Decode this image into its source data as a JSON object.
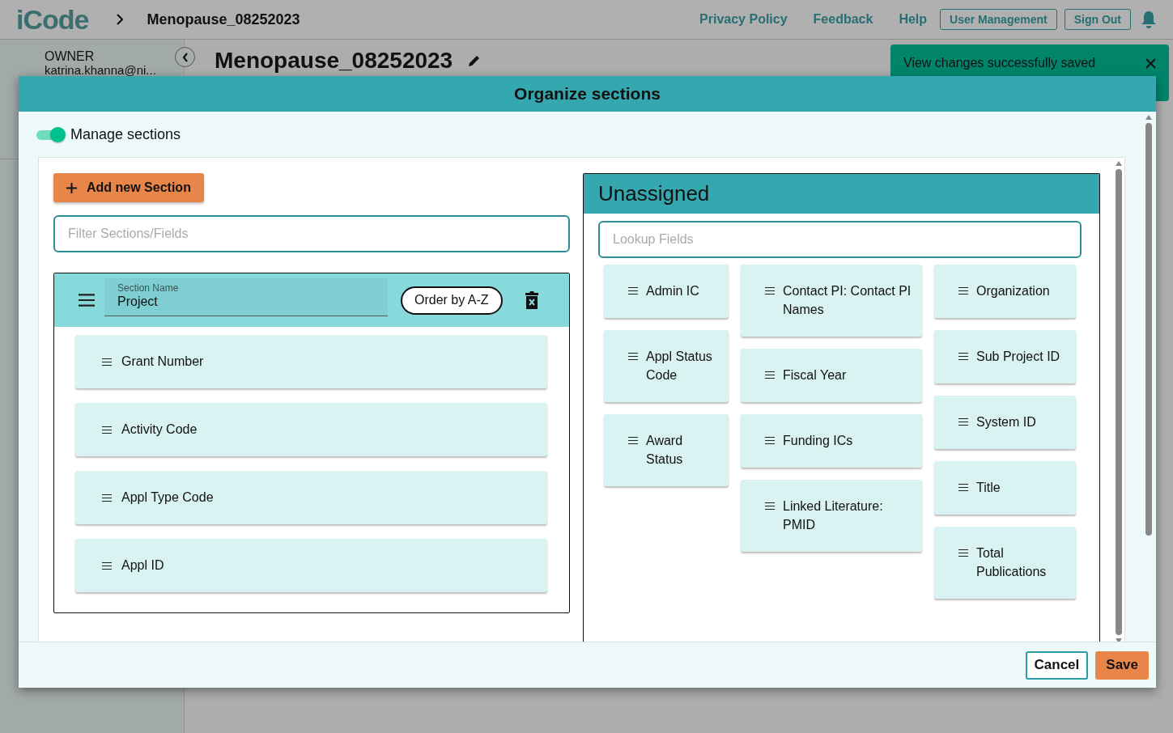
{
  "header": {
    "logo": "iCode",
    "breadcrumb": "Menopause_08252023",
    "links": [
      "Privacy Policy",
      "Feedback",
      "Help"
    ],
    "buttons": [
      "User Management",
      "Sign Out"
    ]
  },
  "sidebar": {
    "role": "OWNER",
    "user": "katrina.khanna@ni..."
  },
  "page": {
    "title": "Menopause_08252023"
  },
  "toast": {
    "message": "View changes successfully saved"
  },
  "dialog": {
    "title": "Organize sections",
    "manage_toggle": {
      "label": "Manage sections",
      "on": true
    },
    "add_button": "Add new Section",
    "filter": {
      "placeholder": "Filter Sections/Fields"
    },
    "sections": [
      {
        "name_label": "Section Name",
        "name": "Project",
        "order_button": "Order by A-Z",
        "fields": [
          "Grant Number",
          "Activity Code",
          "Appl Type Code",
          "Appl ID"
        ]
      }
    ],
    "unassigned": {
      "title": "Unassigned",
      "search": {
        "placeholder": "Lookup Fields"
      },
      "columns": [
        {
          "fields": [
            "Admin IC",
            "Appl Status Code",
            "Award Status"
          ]
        },
        {
          "fields": [
            "Contact PI: Contact PI Names",
            "Fiscal Year",
            "Funding ICs",
            "Linked Literature: PMID"
          ]
        },
        {
          "fields": [
            "Organization",
            "Sub Project ID",
            "System ID",
            "Title",
            "Total Publications"
          ]
        }
      ]
    },
    "buttons": [
      {
        "label": "Cancel",
        "kind": "secondary"
      },
      {
        "label": "Save",
        "kind": "primary"
      }
    ]
  }
}
